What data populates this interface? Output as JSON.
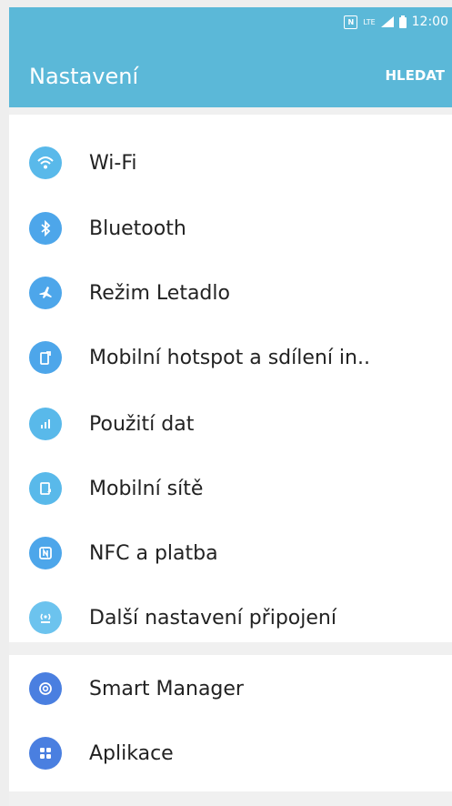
{
  "status_bar": {
    "nfc_icon": "nfc-icon",
    "network": "LTE",
    "signal_icon": "signal-icon",
    "battery_icon": "battery-icon",
    "time": "12:00"
  },
  "header": {
    "title": "Nastavení",
    "search_label": "HLEDAT",
    "background_color": "#5bb8d8"
  },
  "sections": [
    {
      "items": [
        {
          "label": "Wi-Fi",
          "icon": "wifi-icon",
          "color": "#59b9ea"
        },
        {
          "label": "Bluetooth",
          "icon": "bluetooth-icon",
          "color": "#4da6ea"
        },
        {
          "label": "Režim Letadlo",
          "icon": "airplane-icon",
          "color": "#4da6ea"
        },
        {
          "label": "Mobilní hotspot a sdílení in..",
          "icon": "hotspot-icon",
          "color": "#4da6ea"
        },
        {
          "label": "Použití dat",
          "icon": "data-usage-icon",
          "color": "#59b9ea"
        },
        {
          "label": "Mobilní sítě",
          "icon": "mobile-networks-icon",
          "color": "#59b9ea"
        },
        {
          "label": "NFC a platba",
          "icon": "nfc-icon",
          "color": "#4da6ea"
        },
        {
          "label": "Další nastavení připojení",
          "icon": "more-connections-icon",
          "color": "#6cc3ee"
        }
      ]
    },
    {
      "items": [
        {
          "label": "Smart Manager",
          "icon": "smart-manager-icon",
          "color": "#4a7fe0"
        },
        {
          "label": "Aplikace",
          "icon": "apps-icon",
          "color": "#4a7fe0"
        }
      ]
    }
  ]
}
